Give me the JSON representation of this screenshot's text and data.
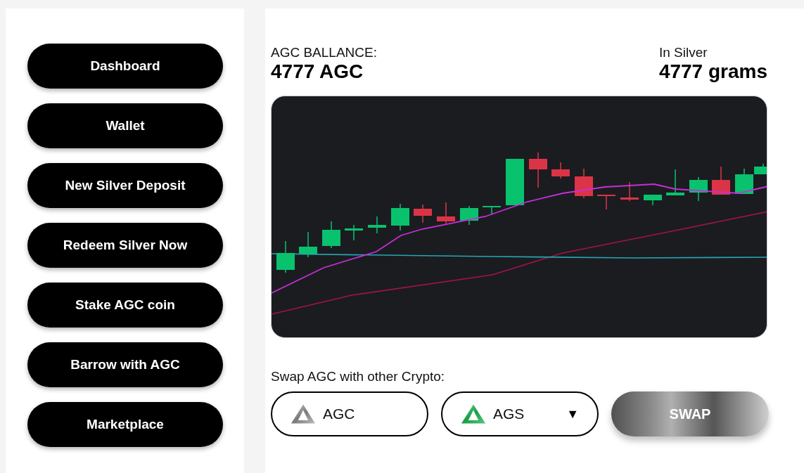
{
  "sidebar": {
    "items": [
      {
        "label": "Dashboard"
      },
      {
        "label": "Wallet"
      },
      {
        "label": "New Silver Deposit"
      },
      {
        "label": "Redeem Silver Now"
      },
      {
        "label": "Stake AGC coin"
      },
      {
        "label": "Barrow with AGC"
      },
      {
        "label": "Marketplace"
      }
    ]
  },
  "balance": {
    "label": "AGC BALLANCE:",
    "value": "4777 AGC"
  },
  "in_silver": {
    "label": "In Silver",
    "value": "4777 grams"
  },
  "swap": {
    "label": "Swap AGC with other Crypto:",
    "from": {
      "symbol": "AGC",
      "kind": "silver"
    },
    "to": {
      "symbol": "AGS",
      "kind": "green",
      "caret": "▼"
    },
    "button": "SWAP"
  }
}
